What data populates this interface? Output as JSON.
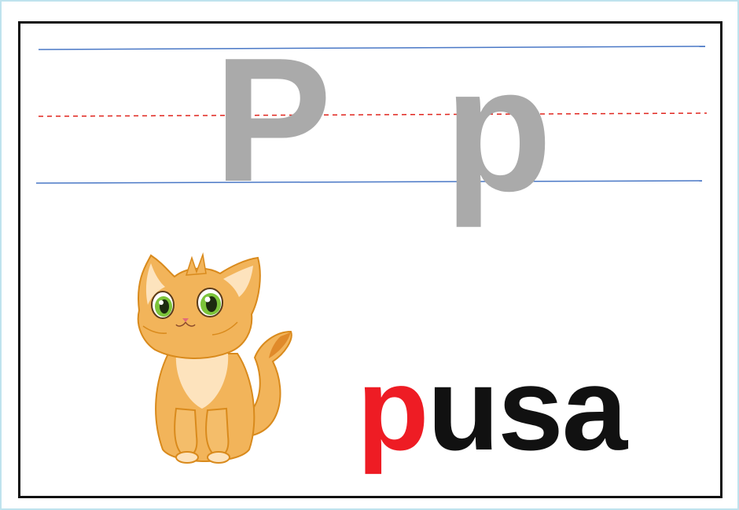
{
  "letters": {
    "uppercase": "P",
    "lowercase": "p"
  },
  "word": {
    "first_letter": "p",
    "rest": "usa"
  },
  "picture": {
    "icon": "cat-icon"
  },
  "colors": {
    "guide_line": "#4a78c6",
    "midline": "#e0261f",
    "letter_gray": "#aaaaaa",
    "highlight_letter": "#ee1c24",
    "word_text": "#111111",
    "cat_fur": "#f2b45a",
    "cat_outline": "#d98a1c"
  }
}
